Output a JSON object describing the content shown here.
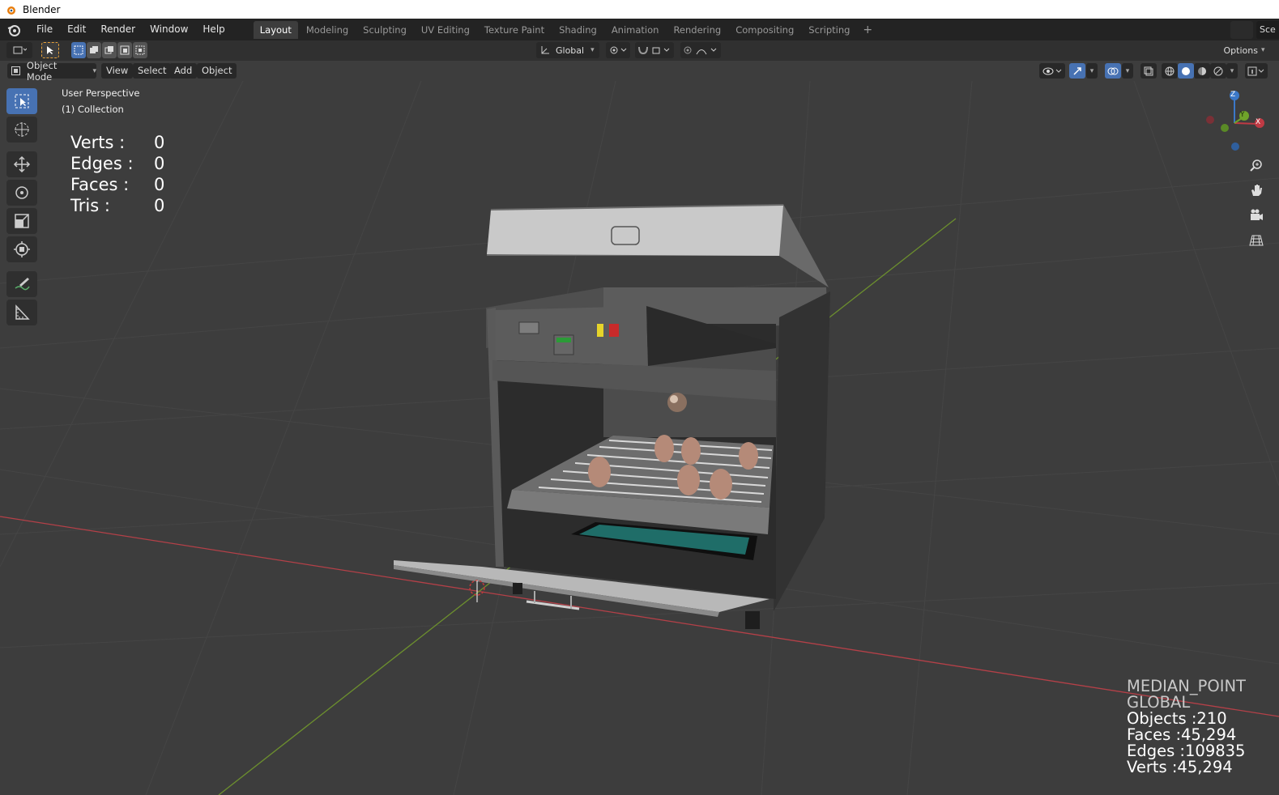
{
  "window": {
    "title": "Blender"
  },
  "menubar": {
    "items": [
      "File",
      "Edit",
      "Render",
      "Window",
      "Help"
    ],
    "workspaces": [
      "Layout",
      "Modeling",
      "Sculpting",
      "UV Editing",
      "Texture Paint",
      "Shading",
      "Animation",
      "Rendering",
      "Compositing",
      "Scripting"
    ],
    "active_workspace": "Layout",
    "add_tab": "+",
    "scene_label": "Sce"
  },
  "toolheader": {
    "orientation": "Global",
    "options_label": "Options"
  },
  "viewport_header": {
    "mode": "Object Mode",
    "menus": [
      "View",
      "Select",
      "Add",
      "Object"
    ]
  },
  "viewport": {
    "perspective": "User Perspective",
    "collection": "(1) Collection",
    "selection_stats": {
      "verts_label": "Verts :",
      "verts": "0",
      "edges_label": "Edges :",
      "edges": "0",
      "faces_label": "Faces :",
      "faces": "0",
      "tris_label": "Tris :",
      "tris": "0"
    },
    "scene_stats": {
      "pivot": "MEDIAN_POINT",
      "orientation": "GLOBAL",
      "objects": "Objects :210",
      "faces": "Faces :45,294",
      "edges": "Edges :109835",
      "verts": "Verts :45,294"
    },
    "gizmo": {
      "x": "X",
      "y": "Y",
      "z": "Z"
    }
  },
  "colors": {
    "accent": "#4772b3",
    "header": "#303030",
    "topbar": "#232323",
    "viewport_bg": "#3d3d3d",
    "x_axis": "#c04048",
    "y_axis": "#7aa33a"
  }
}
